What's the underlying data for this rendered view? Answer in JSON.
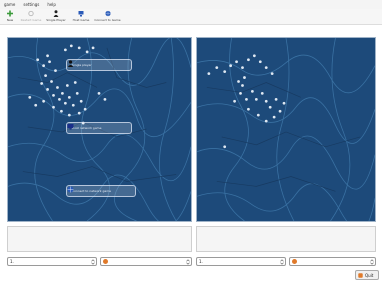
{
  "menu": {
    "items": [
      {
        "label": "game"
      },
      {
        "label": "settings"
      },
      {
        "label": "help"
      }
    ]
  },
  "toolbar": {
    "items": [
      {
        "label": "New",
        "icon": "new-game-icon",
        "enabled": true,
        "color": "#3a9a3a"
      },
      {
        "label": "Restart Game",
        "icon": "restart-icon",
        "enabled": false,
        "color": "#b8b8b8"
      },
      {
        "label": "Single Player",
        "icon": "single-player-icon",
        "enabled": true,
        "color": "#222222"
      },
      {
        "label": "Host Game",
        "icon": "host-game-icon",
        "enabled": true,
        "color": "#2a5ab8"
      },
      {
        "label": "Connect to Game",
        "icon": "connect-icon",
        "enabled": true,
        "color": "#2a5ab8"
      }
    ]
  },
  "start_options": {
    "single_player": "Single player",
    "host_network": "Host network game",
    "connect_network": "Connect to network game"
  },
  "bottom": {
    "left_primary": {
      "value": "1."
    },
    "left_secondary": {
      "icon": "player-avatar-icon"
    },
    "right_primary": {
      "value": "1."
    },
    "right_secondary": {
      "icon": "player-avatar-icon"
    }
  },
  "quit": {
    "label": "Quit"
  },
  "colors": {
    "board": "#1d4a7a",
    "accent": "#e07a2a"
  }
}
